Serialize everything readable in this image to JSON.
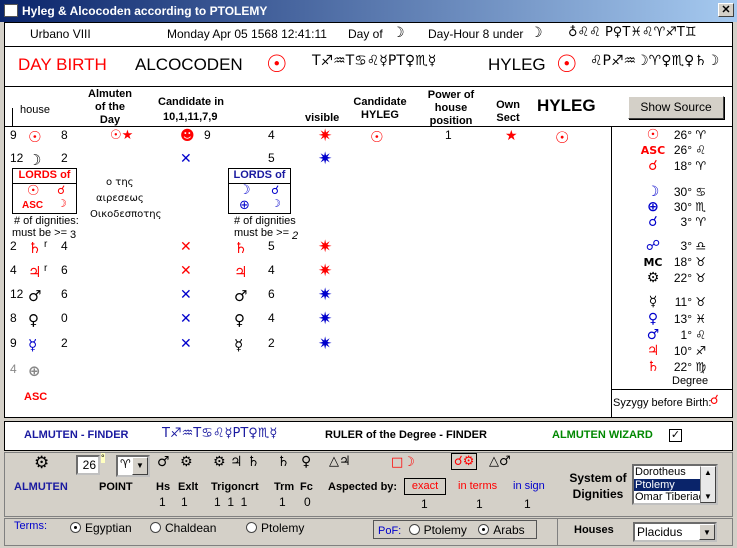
{
  "window": {
    "title": "Hyleg  &  Alcocoden  according to PTOLEMY",
    "close": "✕"
  },
  "info": {
    "name": "Urbano VIII",
    "datetime": "Monday  Apr 05 1568 12:41:11",
    "day_of_label": "Day of",
    "day_of_symbol": "☽",
    "day_hour_label": "Day-Hour 8 under",
    "day_hour_symbol": "☽",
    "glyph_string": "♁♌♌ P♀T♓♌♈♐T♊"
  },
  "banner": {
    "day_birth": "DAY BIRTH",
    "alcocoden_label": "ALCOCODEN",
    "alcocoden_glyphs": "T♐♒T♋♌☿PT♀♏☿",
    "hyleg_label": "HYLEG",
    "hyleg_glyphs": "♌P♐♒☽♈♀♏♀♄☽"
  },
  "headers": {
    "house": "house",
    "almuten_day": "Almuten of the Day",
    "candidate_in": "Candidate  in",
    "candidate_houses": "10,1,11,7,9",
    "visible": "visible",
    "candidate_hyleg": "Candidate HYLEG",
    "power": "Power of house position",
    "own_sect": "Own Sect",
    "hyleg": "HYLEG",
    "show_source": "Show Source"
  },
  "rows": [
    {
      "house": "9",
      "planet": "☉",
      "planet_color": "#f00",
      "retro": "",
      "dignity": "8",
      "almuten": "☉★",
      "cand": "☻",
      "cand_color": "#f00",
      "cand_num": "9",
      "cand2": "",
      "cand2_color": "#000",
      "cand2_num": "4",
      "visible_color": "#f00",
      "hyleg_cand": "☉",
      "power": "1",
      "own_sect": "★",
      "hyleg": "☉"
    },
    {
      "house": "12",
      "planet": "☽",
      "planet_color": "#000",
      "retro": "",
      "dignity": "2",
      "almuten": "",
      "cand": "✕",
      "cand_color": "#00c",
      "cand_num": "",
      "cand2": "",
      "cand2_color": "#000",
      "cand2_num": "5",
      "visible_color": "#00c",
      "hyleg_cand": "",
      "power": "",
      "own_sect": "",
      "hyleg": ""
    },
    {
      "house": "2",
      "planet": "♄",
      "planet_color": "#f00",
      "retro": "r",
      "dignity": "4",
      "almuten": "",
      "cand": "✕",
      "cand_color": "#f00",
      "cand_num": "",
      "cand2": "♄",
      "cand2_color": "#f00",
      "cand2_num": "5",
      "visible_color": "#f00",
      "hyleg_cand": "",
      "power": "",
      "own_sect": "",
      "hyleg": ""
    },
    {
      "house": "4",
      "planet": "♃",
      "planet_color": "#f00",
      "retro": "r",
      "dignity": "6",
      "almuten": "",
      "cand": "✕",
      "cand_color": "#f00",
      "cand_num": "",
      "cand2": "♃",
      "cand2_color": "#f00",
      "cand2_num": "4",
      "visible_color": "#f00",
      "hyleg_cand": "",
      "power": "",
      "own_sect": "",
      "hyleg": ""
    },
    {
      "house": "12",
      "planet": "♂",
      "planet_color": "#000",
      "retro": "",
      "dignity": "6",
      "almuten": "",
      "cand": "✕",
      "cand_color": "#00c",
      "cand_num": "",
      "cand2": "♂",
      "cand2_color": "#000",
      "cand2_num": "6",
      "visible_color": "#00c",
      "hyleg_cand": "",
      "power": "",
      "own_sect": "",
      "hyleg": ""
    },
    {
      "house": "8",
      "planet": "♀",
      "planet_color": "#000",
      "retro": "",
      "dignity": "0",
      "almuten": "",
      "cand": "✕",
      "cand_color": "#00c",
      "cand_num": "",
      "cand2": "♀",
      "cand2_color": "#000",
      "cand2_num": "4",
      "visible_color": "#00c",
      "hyleg_cand": "",
      "power": "",
      "own_sect": "",
      "hyleg": ""
    },
    {
      "house": "9",
      "planet": "☿",
      "planet_color": "#00c",
      "retro": "",
      "dignity": "2",
      "almuten": "",
      "cand": "✕",
      "cand_color": "#00c",
      "cand_num": "",
      "cand2": "☿",
      "cand2_color": "#000",
      "cand2_num": "2",
      "visible_color": "#00c",
      "hyleg_cand": "",
      "power": "",
      "own_sect": "",
      "hyleg": ""
    },
    {
      "house": "4",
      "planet": "⊕",
      "planet_color": "#888",
      "retro": "",
      "dignity": "",
      "almuten": "",
      "cand": "",
      "cand_color": "#000",
      "cand_num": "",
      "cand2": "",
      "cand2_color": "#000",
      "cand2_num": "",
      "visible_color": "",
      "hyleg_cand": "",
      "power": "",
      "own_sect": "",
      "hyleg": ""
    }
  ],
  "asc_label": "ASC",
  "lords_left": {
    "title": "LORDS of",
    "items": [
      "☉",
      "☌",
      "ASC",
      "☽"
    ],
    "dignities_label": "# of dignities:",
    "must_be": "must be >=",
    "value": "3"
  },
  "lords_right": {
    "title": "LORDS of",
    "items": [
      "☽",
      "☌",
      "⊕",
      "☽"
    ],
    "dignities_label": "# of dignities",
    "must_be": "must be >=",
    "value": "2"
  },
  "greek": [
    "ο της",
    "αιρεσεως",
    "Οικοδεσποτης"
  ],
  "positions": [
    {
      "symbol": "☉",
      "color": "#f00",
      "degree": "26°",
      "sign": "♈"
    },
    {
      "symbol": "ASC",
      "color": "#f00",
      "degree": "26°",
      "sign": "♌"
    },
    {
      "symbol": "☌",
      "color": "#f00",
      "degree": "18°",
      "sign": "♈"
    },
    {
      "symbol": "☽",
      "color": "#00c",
      "degree": "30°",
      "sign": "♋"
    },
    {
      "symbol": "⊕",
      "color": "#00c",
      "degree": "30°",
      "sign": "♏"
    },
    {
      "symbol": "☌",
      "color": "#00c",
      "degree": "3°",
      "sign": "♈"
    },
    {
      "symbol": "☍",
      "color": "#00c",
      "degree": "3°",
      "sign": "♎"
    },
    {
      "symbol": "MC",
      "color": "#000",
      "degree": "18°",
      "sign": "♉"
    },
    {
      "symbol": "⚙",
      "color": "#000",
      "degree": "22°",
      "sign": "♉"
    },
    {
      "symbol": "☿",
      "color": "#000",
      "degree": "11°",
      "sign": "♉"
    },
    {
      "symbol": "♀",
      "color": "#00c",
      "degree": "13°",
      "sign": "♓"
    },
    {
      "symbol": "♂",
      "color": "#00c",
      "degree": "1°",
      "sign": "♌"
    },
    {
      "symbol": "♃",
      "color": "#f00",
      "degree": "10°",
      "sign": "♐"
    },
    {
      "symbol": "♄",
      "color": "#f00",
      "degree": "22°",
      "sign": "♍"
    }
  ],
  "degree_label": "Degree",
  "syzygy_label": "Syzygy before Birth:",
  "syzygy_symbol": "☌",
  "finder": {
    "almuten_finder": "ALMUTEN - FINDER",
    "glyphs": "T♐♒T♋♌☿PT♀♏☿",
    "ruler_finder": "RULER of the Degree - FINDER",
    "wizard": "ALMUTEN WIZARD",
    "wizard_checked": "✓"
  },
  "almuten": {
    "gear": "⚙",
    "label": "ALMUTEN",
    "point_label": "POINT",
    "degree_value": "26",
    "degree_mark": "°",
    "sign_value": "♈",
    "row_symbols": [
      "♂",
      "⚙",
      "⚙ ♃ ♄",
      "♄",
      "♀",
      "△♃"
    ],
    "hs": "Hs",
    "exlt": "Exlt",
    "trigoncrt": "Trigoncrt",
    "trm": "Trm",
    "fc": "Fc",
    "hs_v": "1",
    "exlt_v": "1",
    "trig_v": "1  1  1",
    "trm_v": "1",
    "fc_v": "0",
    "aspected_by": "Aspected by:",
    "exact": "exact",
    "in_terms": "in terms",
    "in_sign": "in sign",
    "exact_v": "1",
    "terms_v": "1",
    "sign_v": "1",
    "exact_sym": "□☽",
    "terms_sym": "☌⚙",
    "sign_sym": "△♂",
    "system_label": "System of Dignities",
    "systems": [
      "Dorotheus",
      "Ptolemy",
      "Omar Tiberiac"
    ],
    "system_selected": "Ptolemy"
  },
  "bottom": {
    "terms_label": "Terms:",
    "terms": [
      "Egyptian",
      "Chaldean",
      "Ptolemy"
    ],
    "terms_selected": "Egyptian",
    "pof_label": "PoF:",
    "pof": [
      "Ptolemy",
      "Arabs"
    ],
    "pof_selected": "Arabs",
    "houses_label": "Houses",
    "houses_value": "Placidus"
  },
  "colors": {
    "title_start": "#0a246a",
    "title_end": "#a6caf0",
    "accent_red": "#ff0000",
    "accent_blue": "#0000cc",
    "wizard_green": "#008000"
  }
}
